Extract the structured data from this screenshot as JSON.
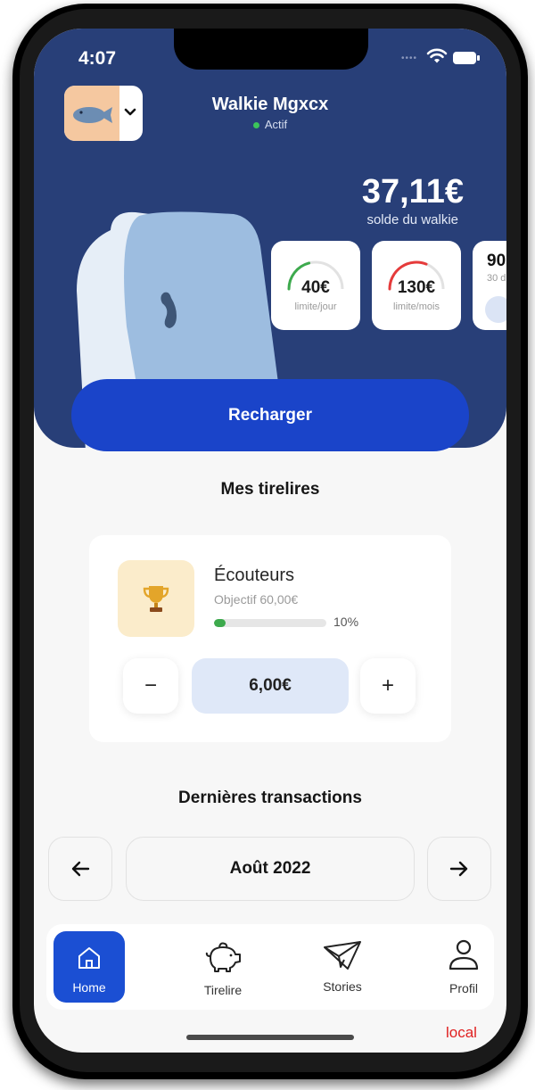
{
  "status_bar": {
    "time": "4:07"
  },
  "header": {
    "device_name": "Walkie Mgxcx",
    "device_status": "Actif",
    "balance": "37,11€",
    "balance_label": "solde du walkie"
  },
  "limits": [
    {
      "value": "40€",
      "label": "limite/jour",
      "fraction": 0.42,
      "color": "#3daa4d"
    },
    {
      "value": "130€",
      "label": "limite/mois",
      "fraction": 0.62,
      "color": "#e63b3b"
    },
    {
      "value": "90",
      "label": "30 d"
    }
  ],
  "actions": {
    "recharge_label": "Recharger"
  },
  "piggy_banks": {
    "title": "Mes tirelires",
    "items": [
      {
        "name": "Écouteurs",
        "target": "Objectif 60,00€",
        "progress": 0.1,
        "progress_label": "10%",
        "icon": "trophy-icon",
        "amount": "6,00€",
        "minus_label": "−",
        "plus_label": "+"
      }
    ]
  },
  "transactions": {
    "title": "Dernières transactions",
    "month": "Août 2022"
  },
  "tab_bar": {
    "items": [
      {
        "label": "Home",
        "icon": "home-icon",
        "active": true
      },
      {
        "label": "Tirelire",
        "icon": "piggy-bank-icon"
      },
      {
        "label": "Stories",
        "icon": "paper-plane-icon"
      },
      {
        "label": "Profil",
        "icon": "user-icon"
      }
    ]
  },
  "environment_label": "local",
  "colors": {
    "header_bg": "#283f78",
    "primary": "#1a44c9",
    "tab_active": "#1b4fd3",
    "progress": "#3daa4d"
  }
}
